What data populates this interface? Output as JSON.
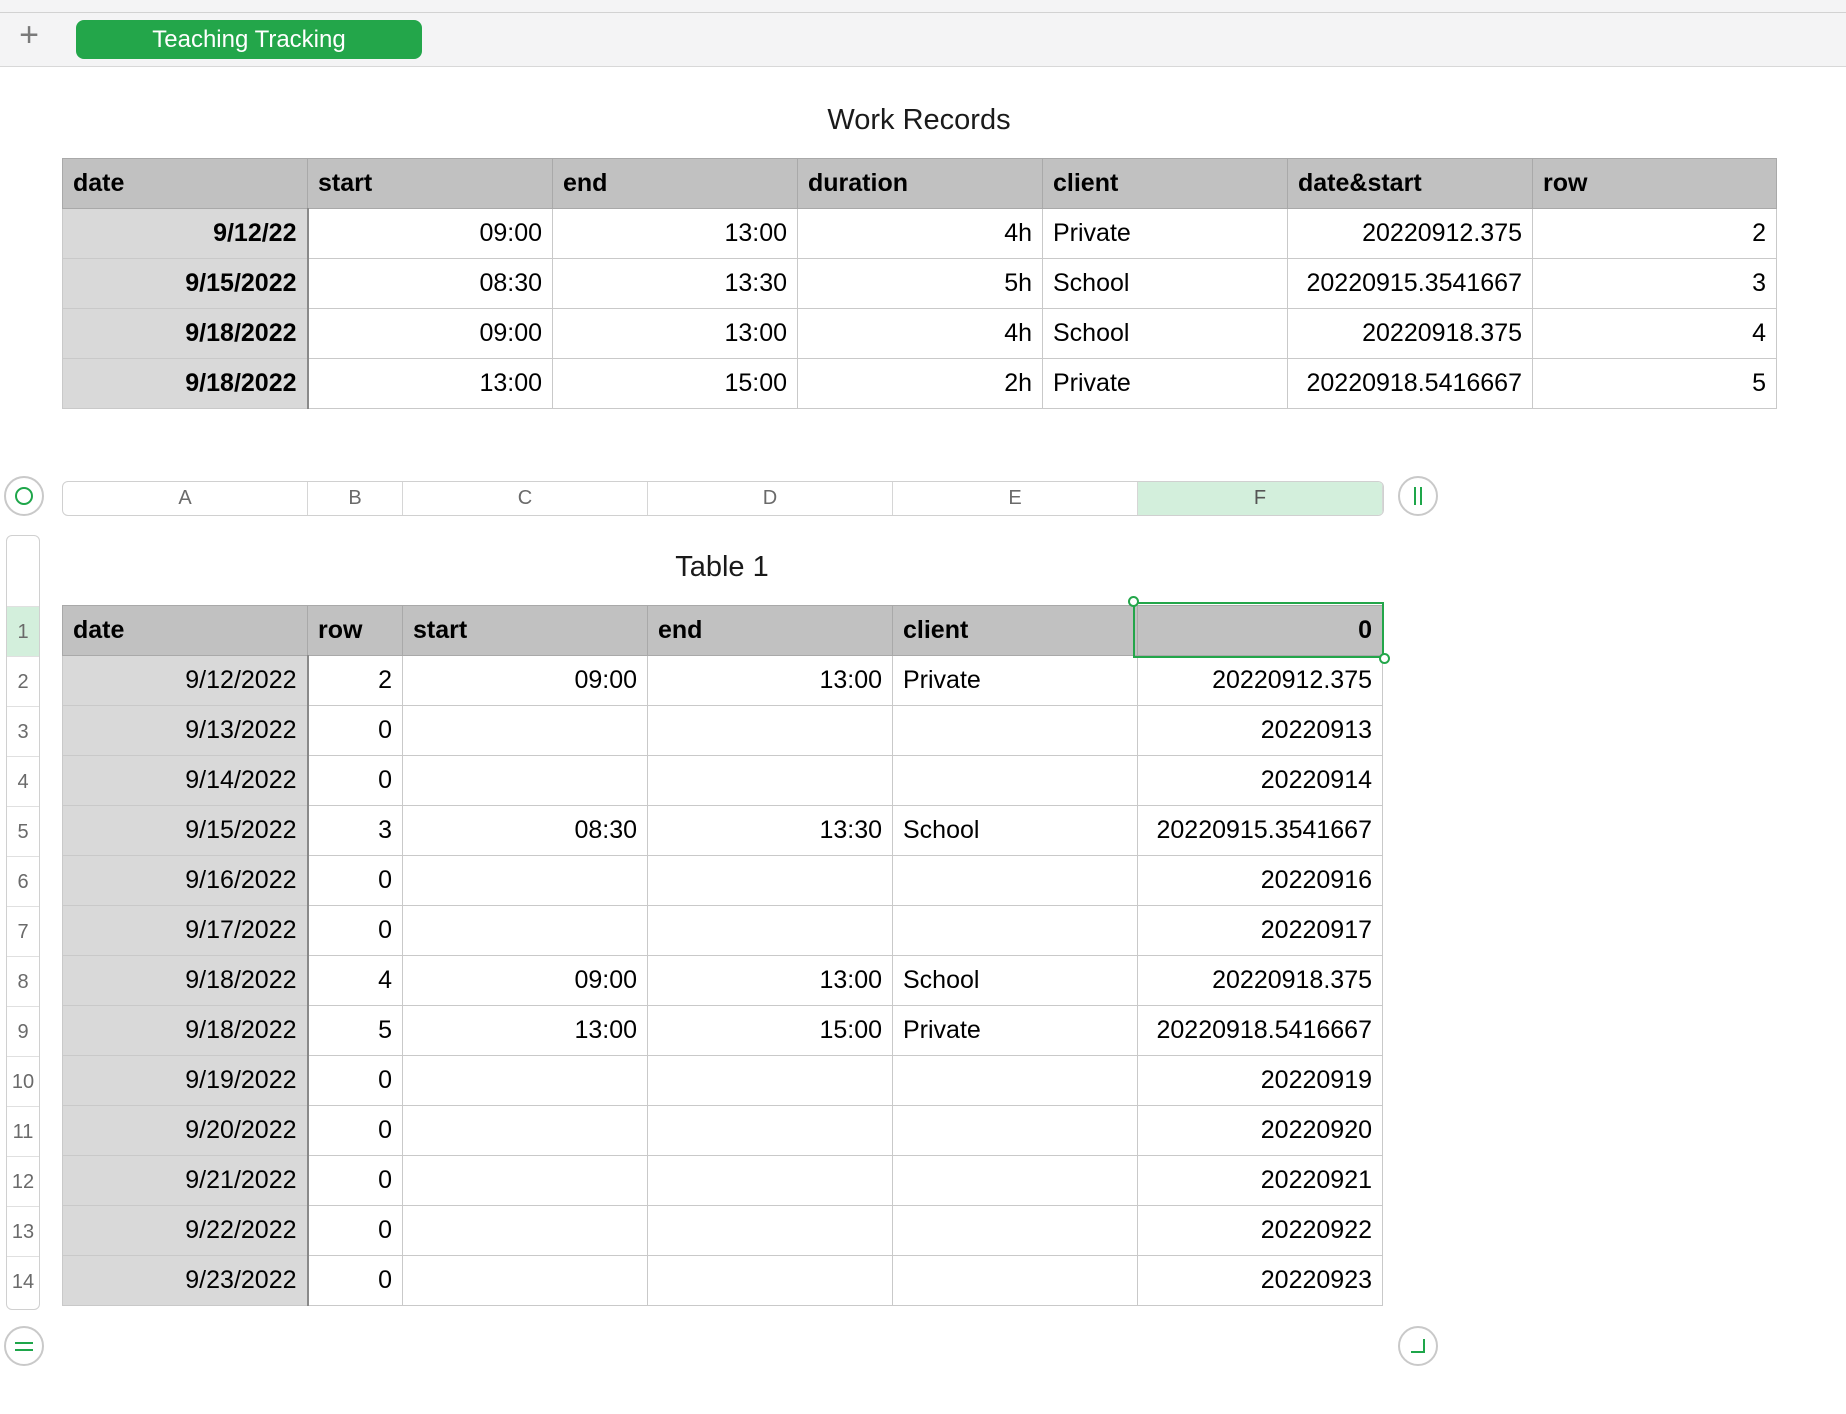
{
  "tabs": {
    "add_icon": "plus-icon",
    "active_sheet": "Teaching Tracking"
  },
  "work_records": {
    "title": "Work Records",
    "headers": [
      "date",
      "start",
      "end",
      "duration",
      "client",
      "date&start",
      "row"
    ],
    "rows": [
      [
        "9/12/22",
        "09:00",
        "13:00",
        "4h",
        "Private",
        "20220912.375",
        "2"
      ],
      [
        "9/15/2022",
        "08:30",
        "13:30",
        "5h",
        "School",
        "20220915.3541667",
        "3"
      ],
      [
        "9/18/2022",
        "09:00",
        "13:00",
        "4h",
        "School",
        "20220918.375",
        "4"
      ],
      [
        "9/18/2022",
        "13:00",
        "15:00",
        "2h",
        "Private",
        "20220918.5416667",
        "5"
      ]
    ]
  },
  "table1": {
    "title": "Table 1",
    "column_letters": [
      "A",
      "B",
      "C",
      "D",
      "E",
      "F"
    ],
    "selected_column": "F",
    "row_numbers": [
      "1",
      "2",
      "3",
      "4",
      "5",
      "6",
      "7",
      "8",
      "9",
      "10",
      "11",
      "12",
      "13",
      "14"
    ],
    "headers": [
      "date",
      "row",
      "start",
      "end",
      "client",
      "0"
    ],
    "rows": [
      [
        "9/12/2022",
        "2",
        "09:00",
        "13:00",
        "Private",
        "20220912.375"
      ],
      [
        "9/13/2022",
        "0",
        "",
        "",
        "",
        "20220913"
      ],
      [
        "9/14/2022",
        "0",
        "",
        "",
        "",
        "20220914"
      ],
      [
        "9/15/2022",
        "3",
        "08:30",
        "13:30",
        "School",
        "20220915.3541667"
      ],
      [
        "9/16/2022",
        "0",
        "",
        "",
        "",
        "20220916"
      ],
      [
        "9/17/2022",
        "0",
        "",
        "",
        "",
        "20220917"
      ],
      [
        "9/18/2022",
        "4",
        "09:00",
        "13:00",
        "School",
        "20220918.375"
      ],
      [
        "9/18/2022",
        "5",
        "13:00",
        "15:00",
        "Private",
        "20220918.5416667"
      ],
      [
        "9/19/2022",
        "0",
        "",
        "",
        "",
        "20220919"
      ],
      [
        "9/20/2022",
        "0",
        "",
        "",
        "",
        "20220920"
      ],
      [
        "9/21/2022",
        "0",
        "",
        "",
        "",
        "20220921"
      ],
      [
        "9/22/2022",
        "0",
        "",
        "",
        "",
        "20220922"
      ],
      [
        "9/23/2022",
        "0",
        "",
        "",
        "",
        "20220923"
      ]
    ]
  },
  "controls": {
    "select_table_icon": "circle-icon",
    "add_column_icon": "double-bar-icon",
    "add_row_icon": "equals-icon",
    "resize_icon": "corner-icon"
  },
  "colors": {
    "accent": "#23a64a",
    "header_bg": "#c1c1c1",
    "header_col_bg": "#d9d9d9",
    "selection_bg": "#d3efdc"
  }
}
